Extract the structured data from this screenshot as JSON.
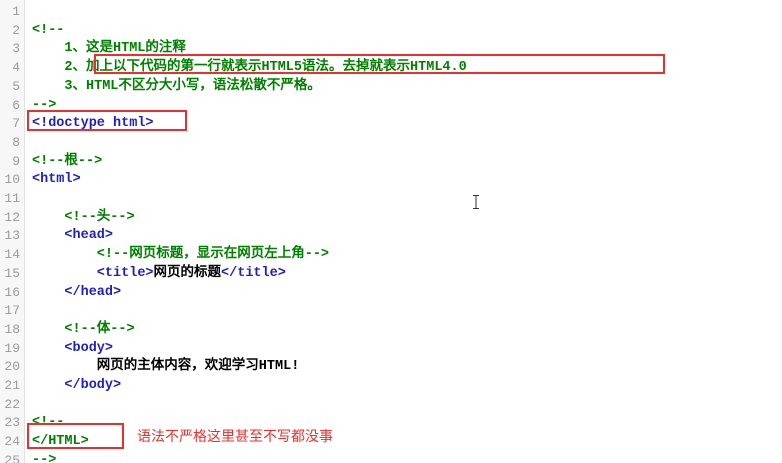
{
  "editor": {
    "lines": [
      {
        "n": "1",
        "segments": []
      },
      {
        "n": "2",
        "segments": [
          {
            "t": "<!--",
            "c": "comment"
          }
        ]
      },
      {
        "n": "3",
        "segments": [
          {
            "t": "    1、这是HTML的注释",
            "c": "comment"
          }
        ]
      },
      {
        "n": "4",
        "segments": [
          {
            "t": "    2、加上以下代码的第一行就表示HTML5语法。去掉就表示HTML4.0",
            "c": "comment"
          }
        ]
      },
      {
        "n": "5",
        "segments": [
          {
            "t": "    3、HTML不区分大小写，语法松散不严格。",
            "c": "comment"
          }
        ]
      },
      {
        "n": "6",
        "segments": [
          {
            "t": "-->",
            "c": "comment"
          }
        ]
      },
      {
        "n": "7",
        "segments": [
          {
            "t": "<!doctype html>",
            "c": "doctype"
          }
        ]
      },
      {
        "n": "8",
        "segments": []
      },
      {
        "n": "9",
        "segments": [
          {
            "t": "<!--根-->",
            "c": "comment"
          }
        ]
      },
      {
        "n": "10",
        "segments": [
          {
            "t": "<html>",
            "c": "tag"
          }
        ]
      },
      {
        "n": "11",
        "segments": []
      },
      {
        "n": "12",
        "segments": [
          {
            "t": "    <!--头-->",
            "c": "comment"
          }
        ]
      },
      {
        "n": "13",
        "segments": [
          {
            "t": "    <head>",
            "c": "tag"
          }
        ]
      },
      {
        "n": "14",
        "segments": [
          {
            "t": "        <!--网页标题，显示在网页左上角-->",
            "c": "comment"
          }
        ]
      },
      {
        "n": "15",
        "segments": [
          {
            "t": "        <title>",
            "c": "tag"
          },
          {
            "t": "网页的标题",
            "c": "text"
          },
          {
            "t": "</title>",
            "c": "tag"
          }
        ]
      },
      {
        "n": "16",
        "segments": [
          {
            "t": "    </head>",
            "c": "tag"
          }
        ]
      },
      {
        "n": "17",
        "segments": []
      },
      {
        "n": "18",
        "segments": [
          {
            "t": "    <!--体-->",
            "c": "comment"
          }
        ]
      },
      {
        "n": "19",
        "segments": [
          {
            "t": "    <body>",
            "c": "tag"
          }
        ]
      },
      {
        "n": "20",
        "segments": [
          {
            "t": "        网页的主体内容，欢迎学习HTML!",
            "c": "text"
          }
        ]
      },
      {
        "n": "21",
        "segments": [
          {
            "t": "    </body>",
            "c": "tag"
          }
        ]
      },
      {
        "n": "22",
        "segments": []
      },
      {
        "n": "23",
        "segments": [
          {
            "t": "<!--",
            "c": "comment"
          }
        ]
      },
      {
        "n": "24",
        "segments": [
          {
            "t": "</HTML>",
            "c": "comment"
          }
        ]
      },
      {
        "n": "25",
        "segments": [
          {
            "t": "-->",
            "c": "comment"
          }
        ]
      }
    ]
  },
  "annotations": {
    "note_text": "语法不严格这里甚至不写都没事",
    "highlight_color": "#e8302e"
  },
  "cursor": {
    "icon": "text-cursor-icon"
  }
}
